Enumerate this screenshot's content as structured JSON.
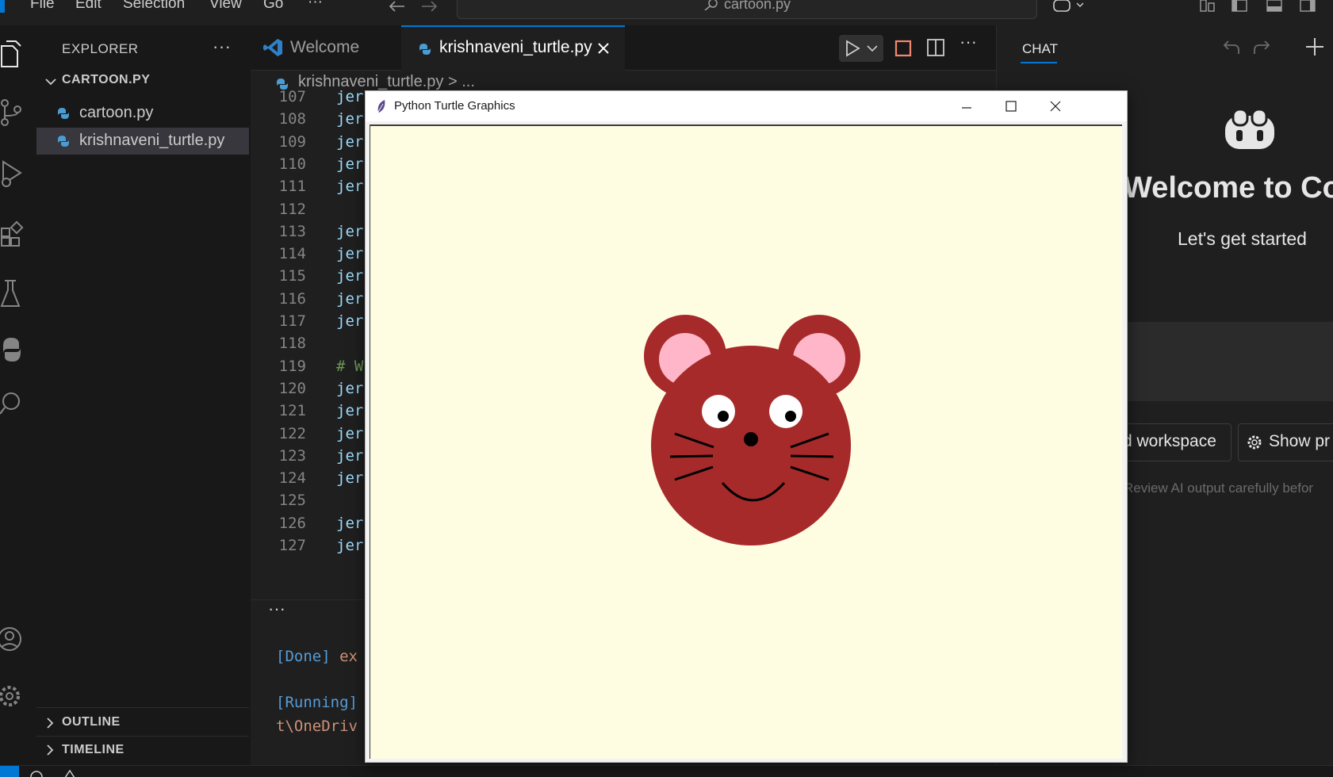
{
  "menu": {
    "items": [
      "File",
      "Edit",
      "Selection",
      "View",
      "Go"
    ],
    "more": "···",
    "search_text": "cartoon.py"
  },
  "sidebar": {
    "title": "EXPLORER",
    "more": "···",
    "folder": "CARTOON.PY",
    "files": [
      "cartoon.py",
      "krishnaveni_turtle.py"
    ],
    "outline": "OUTLINE",
    "timeline": "TIMELINE"
  },
  "tabs": {
    "welcome": "Welcome",
    "active": "krishnaveni_turtle.py"
  },
  "breadcrumb": "krishnaveni_turtle.py > ...",
  "code": {
    "lines": [
      {
        "n": "107",
        "t": "jer"
      },
      {
        "n": "108",
        "t": "jer"
      },
      {
        "n": "109",
        "t": "jer"
      },
      {
        "n": "110",
        "t": "jer"
      },
      {
        "n": "111",
        "t": "jer"
      },
      {
        "n": "112",
        "t": ""
      },
      {
        "n": "113",
        "t": "jer"
      },
      {
        "n": "114",
        "t": "jer"
      },
      {
        "n": "115",
        "t": "jer"
      },
      {
        "n": "116",
        "t": "jer"
      },
      {
        "n": "117",
        "t": "jer"
      },
      {
        "n": "118",
        "t": ""
      },
      {
        "n": "119",
        "t": "# W",
        "comment": true
      },
      {
        "n": "120",
        "t": "jer"
      },
      {
        "n": "121",
        "t": "jer"
      },
      {
        "n": "122",
        "t": "jer"
      },
      {
        "n": "123",
        "t": "jer"
      },
      {
        "n": "124",
        "t": "jer"
      },
      {
        "n": "125",
        "t": ""
      },
      {
        "n": "126",
        "t": "jer"
      },
      {
        "n": "127",
        "t": "jer"
      }
    ]
  },
  "panel": {
    "more": "···",
    "line1_tag": "[Done]",
    "line1_rest": " ex",
    "line2_tag": "[Running]",
    "line3": "t\\OneDriv"
  },
  "chat": {
    "tab": "CHAT",
    "welcome": "Welcome to Cop",
    "subtitle": "Let's get started",
    "workspace_btn": "d workspace",
    "show_btn": "Show pr",
    "review": "Review AI output carefully befor"
  },
  "turtle": {
    "title": "Python Turtle Graphics",
    "face_color": "#a62a2a",
    "ear_inner_color": "#ffb6c8",
    "canvas_color": "#fffde1"
  },
  "colors": {
    "accent": "#0078d4",
    "stop_orange": "#f48771"
  }
}
